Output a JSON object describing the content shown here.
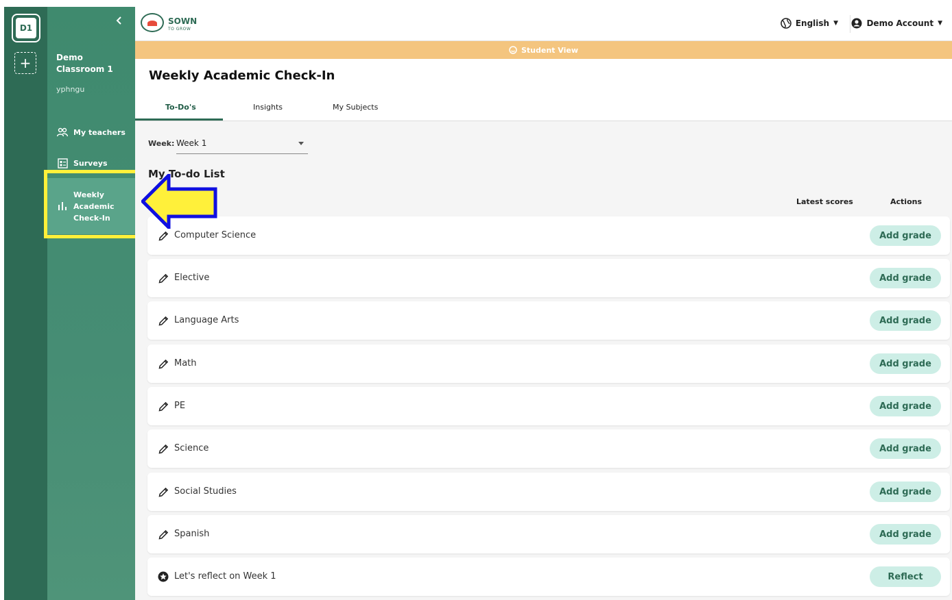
{
  "rail": {
    "class_badge": "D1",
    "add_label": "+"
  },
  "sidebar": {
    "collapse_icon": "chevron-left-icon",
    "class_name": "Demo Classroom 1",
    "user": "yphngu",
    "items": [
      {
        "label": "My teachers",
        "icon": "people-icon"
      },
      {
        "label": "Surveys",
        "icon": "survey-icon"
      },
      {
        "label": "Weekly Academic Check-In",
        "icon": "bar-chart-icon",
        "active": true
      }
    ]
  },
  "header": {
    "logo_main": "SOWN",
    "logo_sub": "TO GROW",
    "language": "English",
    "account": "Demo Account"
  },
  "banner": {
    "text": "Student View"
  },
  "page": {
    "title": "Weekly Academic Check-In",
    "tabs": [
      "To-Do's",
      "Insights",
      "My Subjects"
    ],
    "week_label": "Week:",
    "week_value": "Week 1",
    "list_title": "My To-do List",
    "col_scores": "Latest scores",
    "col_actions": "Actions"
  },
  "rows": [
    {
      "label": "Computer Science",
      "action": "Add grade",
      "icon": "pencil-icon"
    },
    {
      "label": "Elective",
      "action": "Add grade",
      "icon": "pencil-icon"
    },
    {
      "label": "Language Arts",
      "action": "Add grade",
      "icon": "pencil-icon"
    },
    {
      "label": "Math",
      "action": "Add grade",
      "icon": "pencil-icon"
    },
    {
      "label": "PE",
      "action": "Add grade",
      "icon": "pencil-icon"
    },
    {
      "label": "Science",
      "action": "Add grade",
      "icon": "pencil-icon"
    },
    {
      "label": "Social Studies",
      "action": "Add grade",
      "icon": "pencil-icon"
    },
    {
      "label": "Spanish",
      "action": "Add grade",
      "icon": "pencil-icon"
    },
    {
      "label": "Let's reflect on Week 1",
      "action": "Reflect",
      "icon": "star-icon"
    }
  ],
  "colors": {
    "brand_green": "#2e6b55",
    "sidebar_green": "#468d74",
    "active_item": "#5aa48a",
    "banner": "#f4c57f",
    "button_bg": "#cdeee6",
    "annotation_yellow": "#fff03a",
    "annotation_blue": "#1010e0"
  }
}
